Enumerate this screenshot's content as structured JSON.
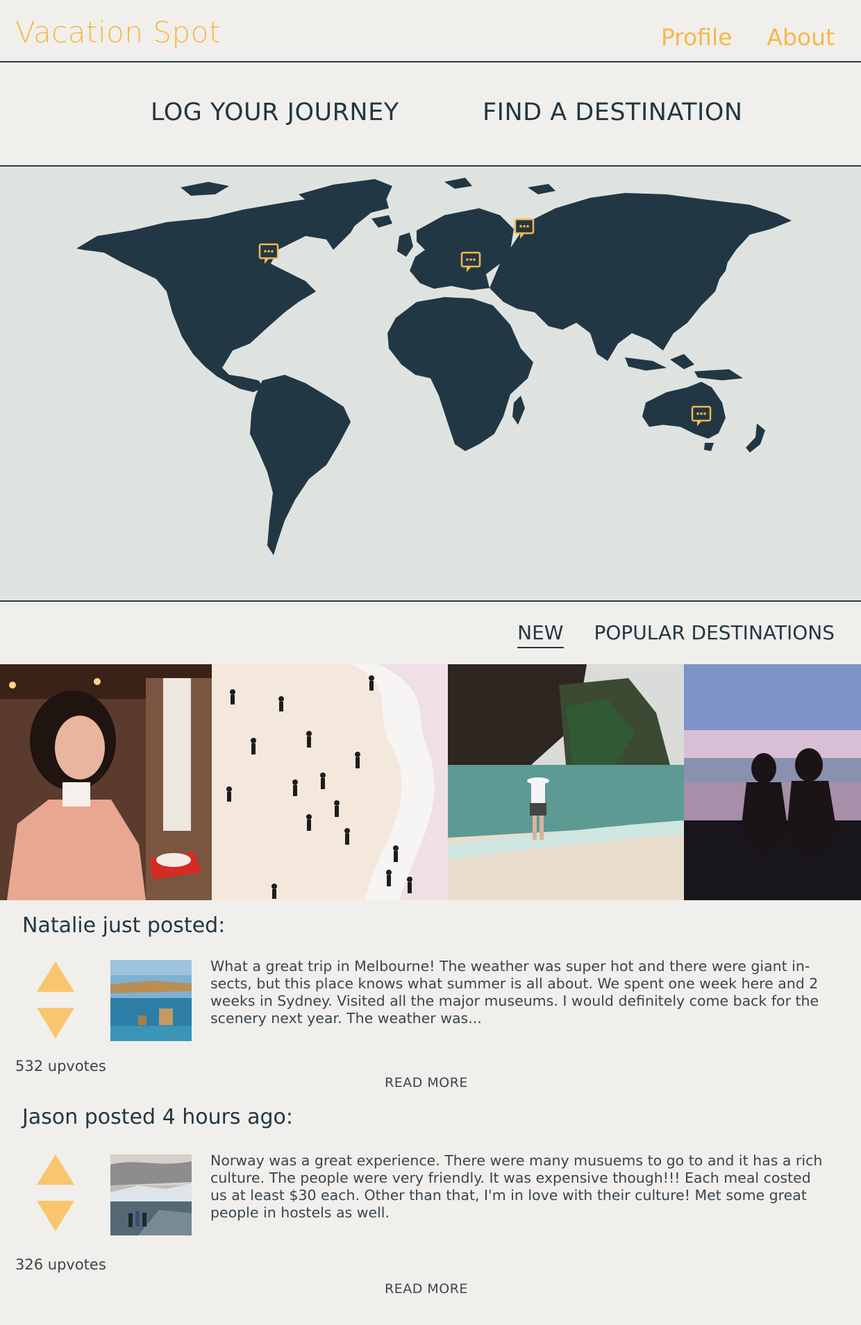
{
  "header": {
    "brand": "Vacation Spot",
    "nav": [
      "Profile",
      "About"
    ]
  },
  "actions": {
    "log": "LOG YOUR JOURNEY",
    "find": "FIND A DESTINATION"
  },
  "map": {
    "land_color": "#223744",
    "sea_color": "#dfe3e0",
    "marker_color": "#f5b84a",
    "markers_icon": "chat-bubble-icon"
  },
  "filters": {
    "items": [
      "NEW",
      "POPULAR DESTINATIONS"
    ],
    "active": "NEW"
  },
  "gallery": [
    "woman-in-pink-jacket",
    "crowded-beach",
    "woman-in-lagoon",
    "two-women-at-sunset-beach"
  ],
  "posts": [
    {
      "heading": "Natalie just posted:",
      "text": "What a great trip in Melbourne! The weather was super hot and there were giant in-sects, but this place knows what summer is all about. We spent one week here and 2 weeks in Sydney. Visited all the major museums. I would definitely come back for the scenery next year. The weather was...",
      "upvotes": "532 upvotes",
      "read_more": "READ MORE"
    },
    {
      "heading": "Jason posted 4 hours ago:",
      "text": "Norway was a great experience. There were many musuems to go to and it has a rich culture. The people were very friendly. It was expensive though!!! Each meal costed us at least $30 each. Other than that, I'm in love with their culture! Met some great people in hostels as well.",
      "upvotes": "326 upvotes",
      "read_more": "READ MORE"
    }
  ]
}
